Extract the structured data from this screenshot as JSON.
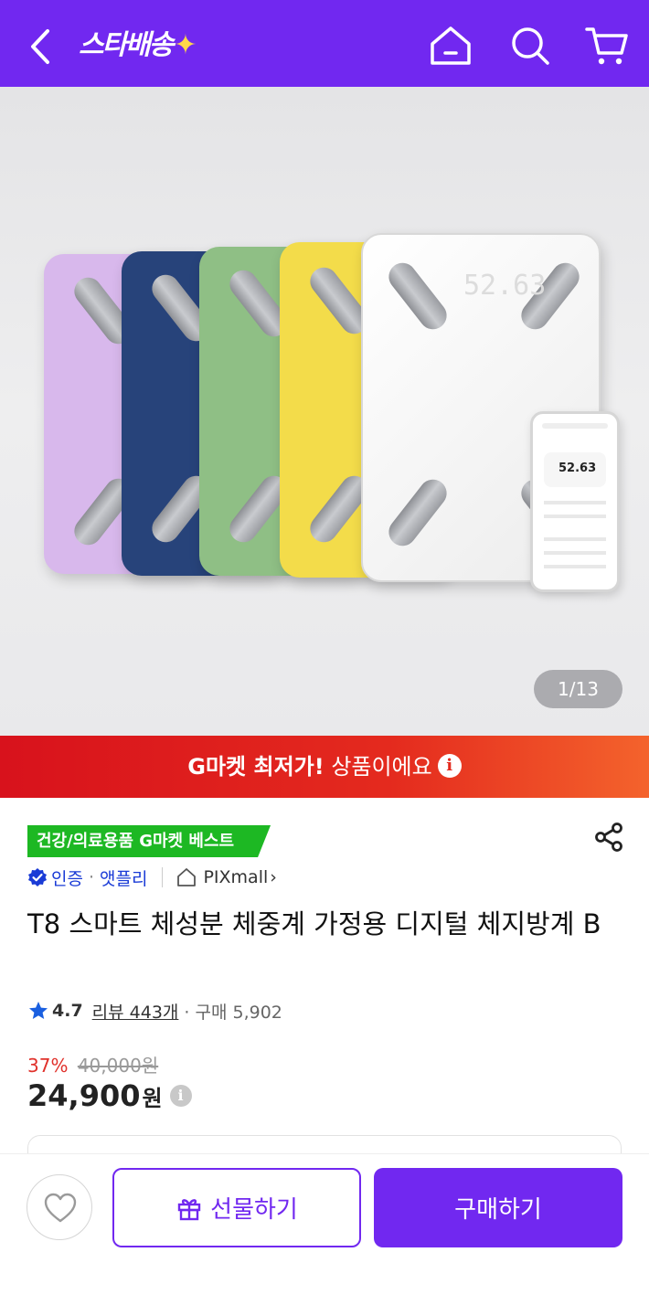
{
  "header": {
    "logo_text": "스타배송",
    "logo_spark": "✦",
    "icons": [
      "back-icon",
      "home-icon",
      "search-icon",
      "cart-icon"
    ]
  },
  "hero": {
    "image_counter": "1/13",
    "display_reading": "52.63",
    "phone_reading": "52.63",
    "scale_colors": [
      "#d8b8ec",
      "#27437a",
      "#8fbf85",
      "#f3dc4a",
      "#f7f7f7"
    ]
  },
  "promo": {
    "bold_text": "G마켓 최저가!",
    "rest_text": " 상품이에요",
    "info_icon": "i"
  },
  "product": {
    "best_badge": "건강/의료용품 G마켓 베스트",
    "cert_label": "인증",
    "dot": "·",
    "cert_brand": "앳플리",
    "store_name": "PIXmall",
    "store_chevron": "›",
    "title": "T8 스마트 체성분 체중계 가정용 디지털 체지방계 B",
    "rating": "4.7",
    "reviews": "리뷰 443개",
    "purchases": "· 구매 5,902",
    "discount": "37%",
    "original_price": "40,000원",
    "price": "24,900",
    "price_unit": "원",
    "price_info_icon": "i"
  },
  "bottom_bar": {
    "gift_label": "선물하기",
    "buy_label": "구매하기"
  },
  "colors": {
    "brand_purple": "#7128f0",
    "promo_red": "#e42a1e",
    "best_green": "#1db823",
    "discount_red": "#e0312b"
  }
}
